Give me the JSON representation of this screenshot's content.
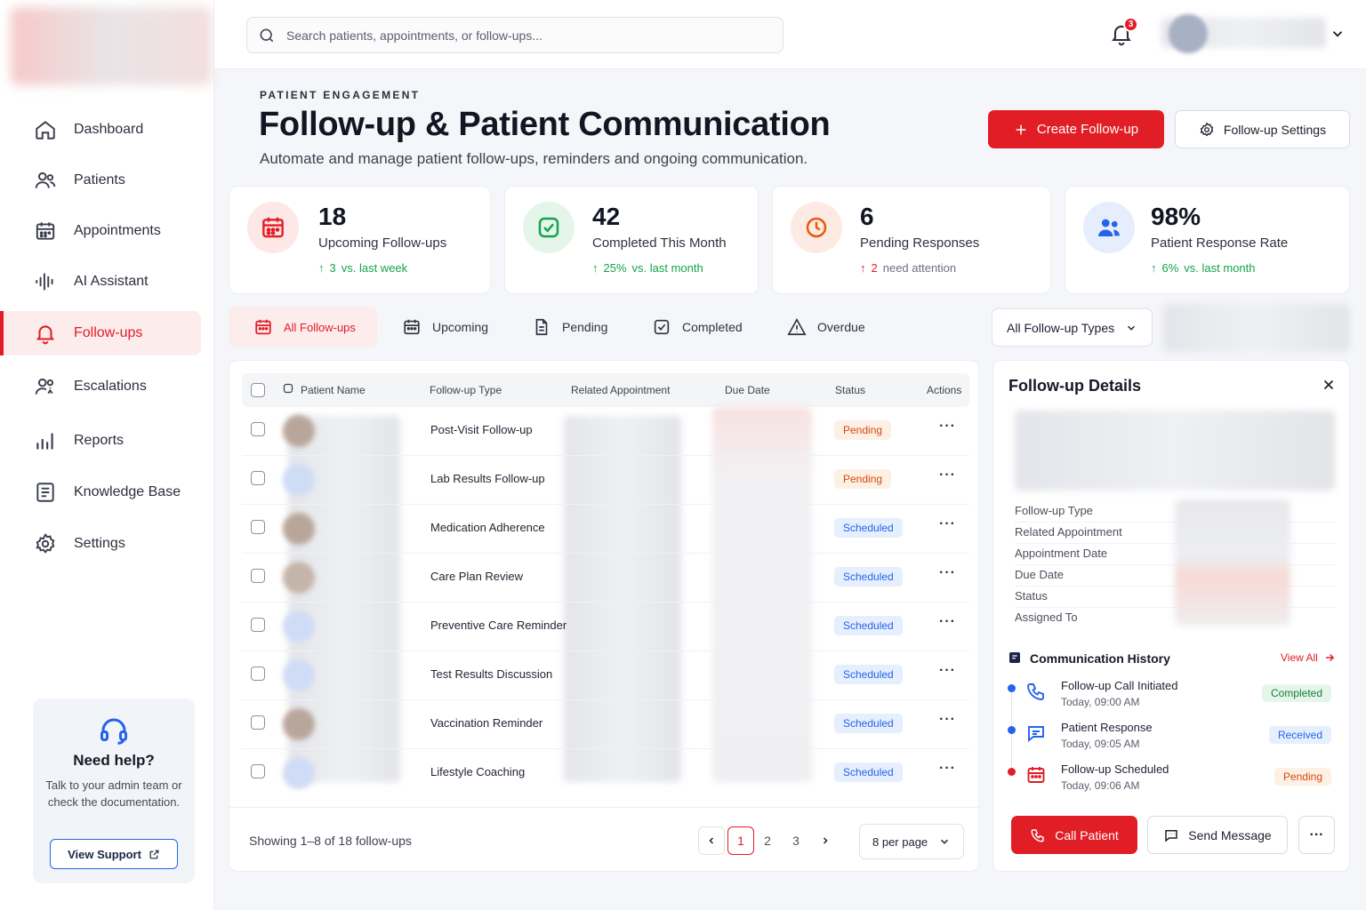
{
  "sidebar": {
    "items": [
      {
        "label": "Dashboard",
        "icon": "home-icon"
      },
      {
        "label": "Patients",
        "icon": "users-icon"
      },
      {
        "label": "Appointments",
        "icon": "calendar-icon"
      },
      {
        "label": "AI Assistant",
        "icon": "waveform-icon"
      },
      {
        "label": "Follow-ups",
        "icon": "bell-icon",
        "active": true
      },
      {
        "label": "Escalations",
        "icon": "user-alert-icon"
      },
      {
        "label": "Reports",
        "icon": "bar-chart-icon"
      },
      {
        "label": "Knowledge Base",
        "icon": "document-icon"
      },
      {
        "label": "Settings",
        "icon": "gear-icon"
      }
    ],
    "help": {
      "title": "Need help?",
      "text": "Talk to your admin team or check the documentation.",
      "button": "View Support"
    }
  },
  "topbar": {
    "search_placeholder": "Search patients, appointments, or follow-ups...",
    "notification_count": "3"
  },
  "header": {
    "eyebrow": "PATIENT ENGAGEMENT",
    "title": "Follow-up & Patient Communication",
    "subtitle": "Automate and manage patient follow-ups, reminders and ongoing communication.",
    "create_button": "Create Follow-up",
    "settings_button": "Follow-up Settings"
  },
  "stats": [
    {
      "value": "18",
      "label": "Upcoming Follow-ups",
      "delta": "3",
      "note": "vs. last week"
    },
    {
      "value": "42",
      "label": "Completed This Month",
      "delta": "25%",
      "note": "vs. last month"
    },
    {
      "value": "6",
      "label": "Pending Responses",
      "delta": "2",
      "note": "need attention"
    },
    {
      "value": "98%",
      "label": "Patient Response Rate",
      "delta": "6%",
      "note": "vs. last month"
    }
  ],
  "tabs": [
    "All Follow-ups",
    "Upcoming",
    "Pending",
    "Completed",
    "Overdue"
  ],
  "type_filter": "All Follow-up Types",
  "table": {
    "columns": [
      "Patient Name",
      "Follow-up Type",
      "Related Appointment",
      "Due Date",
      "Status",
      "Actions"
    ],
    "rows": [
      {
        "type": "Post-Visit Follow-up",
        "status": "Pending"
      },
      {
        "type": "Lab Results Follow-up",
        "status": "Pending"
      },
      {
        "type": "Medication Adherence",
        "status": "Scheduled"
      },
      {
        "type": "Care Plan Review",
        "status": "Scheduled"
      },
      {
        "type": "Preventive Care Reminder",
        "status": "Scheduled"
      },
      {
        "type": "Test Results Discussion",
        "status": "Scheduled"
      },
      {
        "type": "Vaccination Reminder",
        "status": "Scheduled"
      },
      {
        "type": "Lifestyle Coaching",
        "status": "Scheduled"
      }
    ],
    "footer": "Showing 1–8 of 18 follow-ups",
    "pages": [
      "1",
      "2",
      "3"
    ],
    "per_page": "8 per page"
  },
  "details": {
    "title": "Follow-up Details",
    "fields": [
      "Follow-up Type",
      "Related Appointment",
      "Appointment Date",
      "Due Date",
      "Status",
      "Assigned To"
    ],
    "history_title": "Communication History",
    "view_all": "View All",
    "events": [
      {
        "title": "Follow-up Call Initiated",
        "time": "Today, 09:00 AM",
        "status": "Completed"
      },
      {
        "title": "Patient Response",
        "time": "Today, 09:05 AM",
        "status": "Received"
      },
      {
        "title": "Follow-up Scheduled",
        "time": "Today, 09:06 AM",
        "status": "Pending"
      }
    ],
    "call_button": "Call Patient",
    "message_button": "Send Message"
  }
}
